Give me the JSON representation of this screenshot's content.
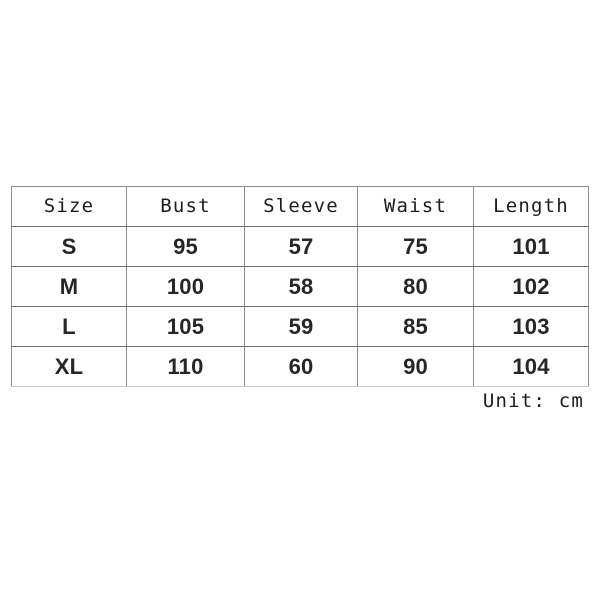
{
  "chart_data": {
    "type": "table",
    "title": "",
    "columns": [
      "Size",
      "Bust",
      "Sleeve",
      "Waist",
      "Length"
    ],
    "rows": [
      [
        "S",
        "95",
        "57",
        "75",
        "101"
      ],
      [
        "M",
        "100",
        "58",
        "80",
        "102"
      ],
      [
        "L",
        "105",
        "59",
        "85",
        "103"
      ],
      [
        "XL",
        "110",
        "60",
        "90",
        "104"
      ]
    ],
    "unit_note": "Unit: cm",
    "grid": true,
    "legend": "none"
  },
  "table": {
    "headers": {
      "size": "Size",
      "bust": "Bust",
      "sleeve": "Sleeve",
      "waist": "Waist",
      "length": "Length"
    },
    "rows": [
      {
        "size": "S",
        "bust": "95",
        "sleeve": "57",
        "waist": "75",
        "length": "101"
      },
      {
        "size": "M",
        "bust": "100",
        "sleeve": "58",
        "waist": "80",
        "length": "102"
      },
      {
        "size": "L",
        "bust": "105",
        "sleeve": "59",
        "waist": "85",
        "length": "103"
      },
      {
        "size": "XL",
        "bust": "110",
        "sleeve": "60",
        "waist": "90",
        "length": "104"
      }
    ]
  },
  "footer": {
    "unit_label": "Unit: cm"
  },
  "colors": {
    "background": "#ffffff",
    "header_text": "#1c1c1c",
    "data_text": "#262626",
    "border": "#8c8c8c",
    "border_bottom_last": "#c9c9c9"
  }
}
